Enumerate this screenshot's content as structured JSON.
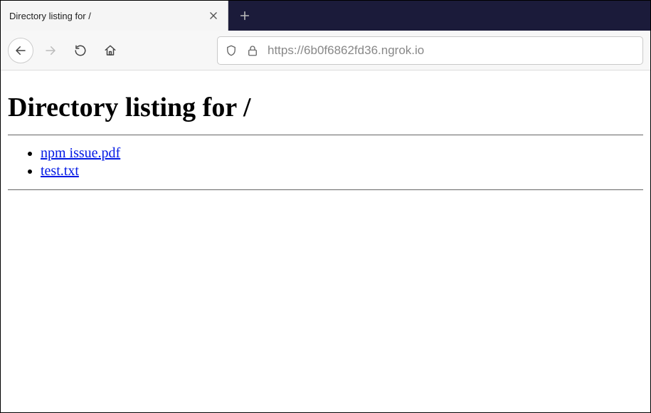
{
  "browser": {
    "tab_title": "Directory listing for /",
    "url_protocol": "https://",
    "url_hostpath": "6b0f6862fd36.ngrok.io"
  },
  "page": {
    "heading": "Directory listing for /",
    "files": [
      {
        "name": "npm issue.pdf"
      },
      {
        "name": "test.txt"
      }
    ]
  }
}
